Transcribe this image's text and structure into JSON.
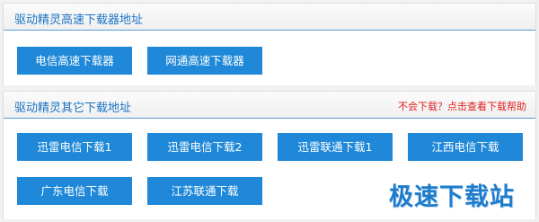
{
  "section_high_speed": {
    "title": "驱动精灵高速下载器地址",
    "buttons": [
      {
        "label": "电信高速下载器"
      },
      {
        "label": "网通高速下载器"
      }
    ]
  },
  "section_other": {
    "title": "驱动精灵其它下载地址",
    "help_link": "不会下载？点击查看下载帮助",
    "buttons": [
      {
        "label": "迅雷电信下载1"
      },
      {
        "label": "迅雷电信下载2"
      },
      {
        "label": "迅雷联通下载1"
      },
      {
        "label": "江西电信下载"
      },
      {
        "label": "广东电信下载"
      },
      {
        "label": "江苏联通下载"
      }
    ]
  },
  "watermark": "极速下载站",
  "colors": {
    "button_bg": "#1f88d8",
    "title_text": "#1a73c4",
    "help_link": "#e02020",
    "watermark": "#1e7ccc"
  }
}
